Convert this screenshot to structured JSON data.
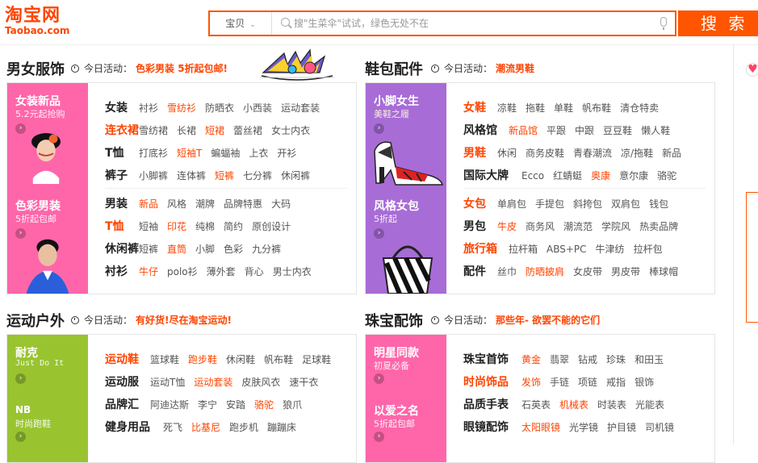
{
  "header": {
    "logo_cn": "淘宝网",
    "logo_en": "Taobao.com",
    "search_type": "宝贝",
    "search_placeholder": "搜\"生菜伞\"试试，绿色无处不在",
    "search_button": "搜 索"
  },
  "sections": [
    {
      "title": "男女服饰",
      "activity_label": "今日活动：",
      "activity": "色彩男装 5折起包邮!",
      "promos": [
        {
          "title": "女装新品",
          "subtitle": "5.2元起抢购"
        },
        {
          "title": "色彩男装",
          "subtitle": "5折起包邮"
        }
      ],
      "rows": [
        {
          "title": "女装",
          "title_hl": false,
          "links": [
            {
              "t": "衬衫"
            },
            {
              "t": "雪纺衫",
              "hl": true
            },
            {
              "t": "防晒衣"
            },
            {
              "t": "小西装"
            },
            {
              "t": "运动套装"
            }
          ]
        },
        {
          "title": "连衣裙",
          "title_hl": true,
          "links": [
            {
              "t": "雪纺裙"
            },
            {
              "t": "长裙"
            },
            {
              "t": "短裙",
              "hl": true
            },
            {
              "t": "蕾丝裙"
            },
            {
              "t": "女士内衣"
            }
          ]
        },
        {
          "title": "T恤",
          "title_hl": false,
          "links": [
            {
              "t": "打底衫"
            },
            {
              "t": "短袖T",
              "hl": true
            },
            {
              "t": "蝙蝠袖"
            },
            {
              "t": "上衣"
            },
            {
              "t": "开衫"
            }
          ]
        },
        {
          "title": "裤子",
          "title_hl": false,
          "links": [
            {
              "t": "小脚裤"
            },
            {
              "t": "连体裤"
            },
            {
              "t": "短裤",
              "hl": true
            },
            {
              "t": "七分裤"
            },
            {
              "t": "休闲裤"
            }
          ]
        },
        {
          "title": "男装",
          "title_hl": false,
          "links": [
            {
              "t": "新品",
              "hl": true
            },
            {
              "t": "风格"
            },
            {
              "t": "潮牌"
            },
            {
              "t": "品牌特惠"
            },
            {
              "t": "大码"
            }
          ]
        },
        {
          "title": "T恤",
          "title_hl": true,
          "links": [
            {
              "t": "短袖"
            },
            {
              "t": "印花",
              "hl": true
            },
            {
              "t": "纯棉"
            },
            {
              "t": "简约"
            },
            {
              "t": "原创设计"
            }
          ]
        },
        {
          "title": "休闲裤",
          "title_hl": false,
          "links": [
            {
              "t": "短裤"
            },
            {
              "t": "直筒",
              "hl": true
            },
            {
              "t": "小脚"
            },
            {
              "t": "色彩"
            },
            {
              "t": "九分裤"
            }
          ]
        },
        {
          "title": "衬衫",
          "title_hl": false,
          "links": [
            {
              "t": "牛仔",
              "hl": true
            },
            {
              "t": "polo衫"
            },
            {
              "t": "薄外套"
            },
            {
              "t": "背心"
            },
            {
              "t": "男士内衣"
            }
          ]
        }
      ]
    },
    {
      "title": "鞋包配件",
      "activity_label": "今日活动：",
      "activity": "潮流男鞋",
      "promos": [
        {
          "title": "小脚女生",
          "subtitle": "美鞋之履"
        },
        {
          "title": "风格女包",
          "subtitle": "5折起"
        }
      ],
      "rows": [
        {
          "title": "女鞋",
          "title_hl": true,
          "links": [
            {
              "t": "凉鞋"
            },
            {
              "t": "拖鞋"
            },
            {
              "t": "单鞋"
            },
            {
              "t": "帆布鞋"
            },
            {
              "t": "清仓特卖"
            }
          ]
        },
        {
          "title": "风格馆",
          "title_hl": false,
          "links": [
            {
              "t": "新品馆",
              "hl": true
            },
            {
              "t": "平跟"
            },
            {
              "t": "中跟"
            },
            {
              "t": "豆豆鞋"
            },
            {
              "t": "懒人鞋"
            }
          ]
        },
        {
          "title": "男鞋",
          "title_hl": true,
          "links": [
            {
              "t": "休闲"
            },
            {
              "t": "商务皮鞋"
            },
            {
              "t": "青春潮流"
            },
            {
              "t": "凉/拖鞋"
            },
            {
              "t": "新品"
            }
          ]
        },
        {
          "title": "国际大牌",
          "title_hl": false,
          "links": [
            {
              "t": "Ecco"
            },
            {
              "t": "红蜻蜓"
            },
            {
              "t": "奥康",
              "hl": true
            },
            {
              "t": "意尔康"
            },
            {
              "t": "骆驼"
            }
          ]
        },
        {
          "title": "女包",
          "title_hl": true,
          "links": [
            {
              "t": "单肩包"
            },
            {
              "t": "手提包"
            },
            {
              "t": "斜挎包"
            },
            {
              "t": "双肩包"
            },
            {
              "t": "钱包"
            }
          ]
        },
        {
          "title": "男包",
          "title_hl": false,
          "links": [
            {
              "t": "牛皮",
              "hl": true
            },
            {
              "t": "商务风"
            },
            {
              "t": "潮流范"
            },
            {
              "t": "学院风"
            },
            {
              "t": "热卖品牌"
            }
          ]
        },
        {
          "title": "旅行箱",
          "title_hl": true,
          "links": [
            {
              "t": "拉杆箱"
            },
            {
              "t": "ABS+PC"
            },
            {
              "t": "牛津纺"
            },
            {
              "t": "拉杆包"
            }
          ]
        },
        {
          "title": "配件",
          "title_hl": false,
          "links": [
            {
              "t": "丝巾"
            },
            {
              "t": "防晒披肩",
              "hl": true
            },
            {
              "t": "女皮带"
            },
            {
              "t": "男皮带"
            },
            {
              "t": "棒球帽"
            }
          ]
        }
      ]
    },
    {
      "title": "运动户外",
      "activity_label": "今日活动：",
      "activity": "有好货!尽在淘宝运动!",
      "promos": [
        {
          "title": "耐克",
          "subtitle": "Just Do It"
        },
        {
          "title": "NB",
          "subtitle": "时尚跑鞋"
        }
      ],
      "rows": [
        {
          "title": "运动鞋",
          "title_hl": true,
          "links": [
            {
              "t": "篮球鞋"
            },
            {
              "t": "跑步鞋",
              "hl": true
            },
            {
              "t": "休闲鞋"
            },
            {
              "t": "帆布鞋"
            },
            {
              "t": "足球鞋"
            }
          ]
        },
        {
          "title": "运动服",
          "title_hl": false,
          "links": [
            {
              "t": "运动T恤"
            },
            {
              "t": "运动套装",
              "hl": true
            },
            {
              "t": "皮肤风衣"
            },
            {
              "t": "速干衣"
            }
          ]
        },
        {
          "title": "品牌汇",
          "title_hl": false,
          "links": [
            {
              "t": "阿迪达斯"
            },
            {
              "t": "李宁"
            },
            {
              "t": "安踏"
            },
            {
              "t": "骆驼",
              "hl": true
            },
            {
              "t": "狼爪"
            }
          ]
        },
        {
          "title": "健身用品",
          "title_hl": false,
          "links": [
            {
              "t": "死飞"
            },
            {
              "t": "比基尼",
              "hl": true
            },
            {
              "t": "跑步机"
            },
            {
              "t": "蹦蹦床"
            }
          ]
        }
      ]
    },
    {
      "title": "珠宝配饰",
      "activity_label": "今日活动：",
      "activity": "那些年- 欲罢不能的它们",
      "promos": [
        {
          "title": "明星同款",
          "subtitle": "初夏必备"
        },
        {
          "title": "以爱之名",
          "subtitle": "5折起包邮"
        }
      ],
      "rows": [
        {
          "title": "珠宝首饰",
          "title_hl": false,
          "links": [
            {
              "t": "黄金",
              "hl": true
            },
            {
              "t": "翡翠"
            },
            {
              "t": "钻戒"
            },
            {
              "t": "珍珠"
            },
            {
              "t": "和田玉"
            }
          ]
        },
        {
          "title": "时尚饰品",
          "title_hl": true,
          "links": [
            {
              "t": "发饰",
              "hl": true
            },
            {
              "t": "手链"
            },
            {
              "t": "项链"
            },
            {
              "t": "戒指"
            },
            {
              "t": "银饰"
            }
          ]
        },
        {
          "title": "品质手表",
          "title_hl": false,
          "links": [
            {
              "t": "石英表"
            },
            {
              "t": "机械表",
              "hl": true
            },
            {
              "t": "时装表"
            },
            {
              "t": "光能表"
            }
          ]
        },
        {
          "title": "眼镜配饰",
          "title_hl": false,
          "links": [
            {
              "t": "太阳眼镜",
              "hl": true
            },
            {
              "t": "光学镜"
            },
            {
              "t": "护目镜"
            },
            {
              "t": "司机镜"
            }
          ]
        }
      ]
    }
  ]
}
